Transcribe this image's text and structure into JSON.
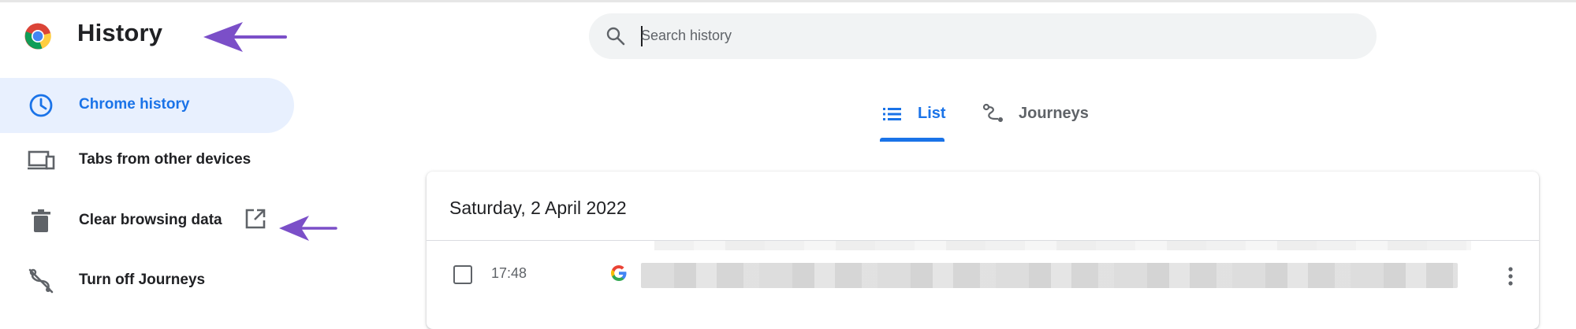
{
  "header": {
    "title": "History",
    "search_placeholder": "Search history"
  },
  "sidebar": {
    "items": [
      {
        "label": "Chrome history",
        "icon": "clock-icon",
        "active": true
      },
      {
        "label": "Tabs from other devices",
        "icon": "devices-icon",
        "active": false
      },
      {
        "label": "Clear browsing data",
        "icon": "trash-icon",
        "active": false,
        "external_icon": "open-in-new-icon"
      },
      {
        "label": "Turn off Journeys",
        "icon": "journeys-off-icon",
        "active": false
      }
    ]
  },
  "tabs": [
    {
      "label": "List",
      "icon": "list-icon",
      "active": true
    },
    {
      "label": "Journeys",
      "icon": "journeys-icon",
      "active": false
    }
  ],
  "history": {
    "date": "Saturday, 2 April 2022",
    "entries": [
      {
        "time": "17:48",
        "favicon": "google-g-icon"
      }
    ]
  },
  "colors": {
    "accent": "#1a73e8",
    "active_bg": "#e8f0fe",
    "annotation_arrow": "#7b4fc8"
  }
}
